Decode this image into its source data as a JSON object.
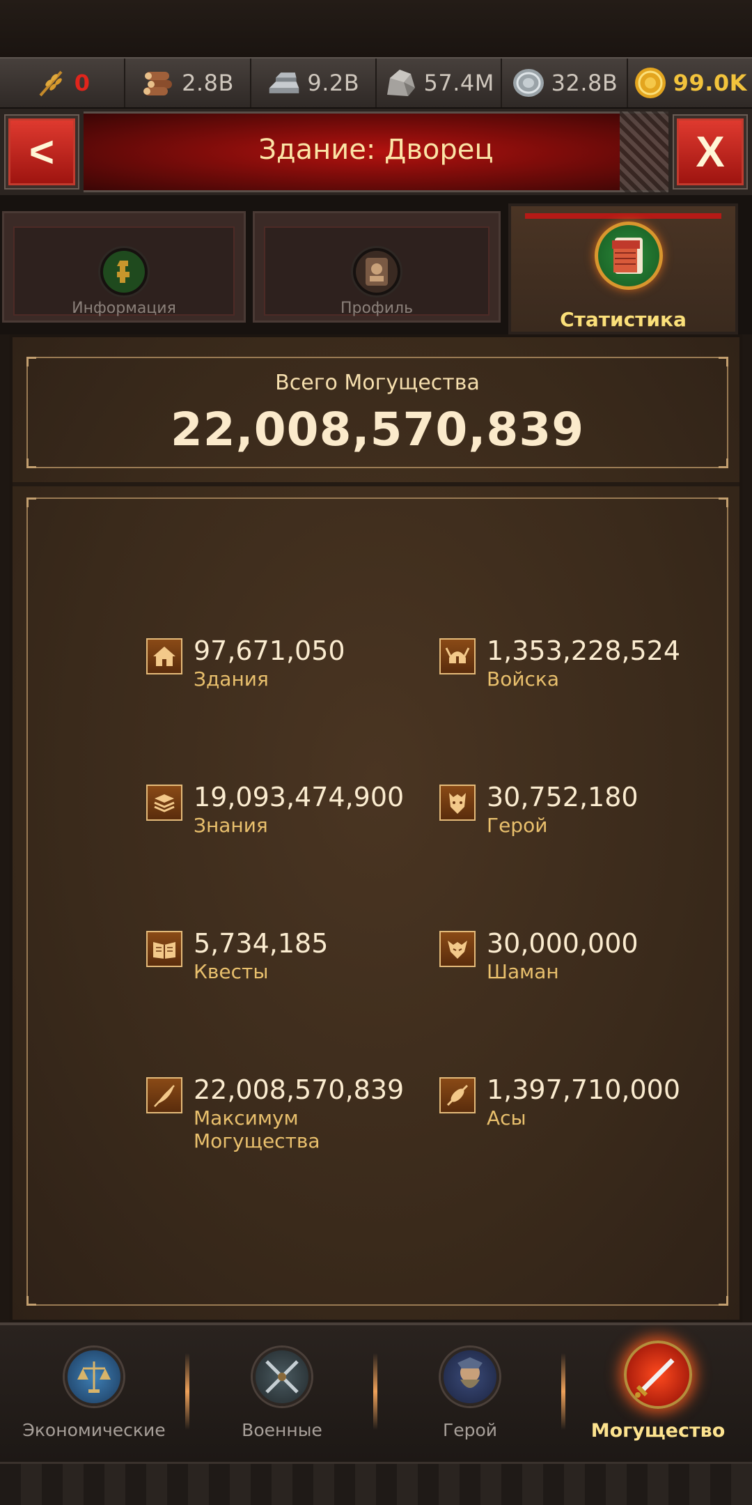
{
  "resources": [
    {
      "icon": "wheat-icon",
      "value": "0",
      "style": "red"
    },
    {
      "icon": "wood-icon",
      "value": "2.8B",
      "style": ""
    },
    {
      "icon": "iron-icon",
      "value": "9.2B",
      "style": ""
    },
    {
      "icon": "stone-icon",
      "value": "57.4M",
      "style": ""
    },
    {
      "icon": "silver-icon",
      "value": "32.8B",
      "style": ""
    },
    {
      "icon": "gold-icon",
      "value": "99.0K",
      "style": "gold"
    }
  ],
  "header": {
    "title": "Здание:  Дворец",
    "back_label": "<",
    "close_label": "X"
  },
  "tabs": [
    {
      "label": "Информация",
      "icon": "info-icon",
      "active": false
    },
    {
      "label": "Профиль",
      "icon": "profile-icon",
      "active": false
    },
    {
      "label": "Статистика",
      "icon": "statistics-icon",
      "active": true
    }
  ],
  "total": {
    "label": "Всего Могущества",
    "value": "22,008,570,839"
  },
  "stats": [
    {
      "icon": "house-icon",
      "value": "97,671,050",
      "label": "Здания"
    },
    {
      "icon": "helmet-icon",
      "value": "1,353,228,524",
      "label": "Войска"
    },
    {
      "icon": "books-icon",
      "value": "19,093,474,900",
      "label": "Знания"
    },
    {
      "icon": "hero-icon",
      "value": "30,752,180",
      "label": "Герой"
    },
    {
      "icon": "open-book-icon",
      "value": "5,734,185",
      "label": "Квесты"
    },
    {
      "icon": "shaman-icon",
      "value": "30,000,000",
      "label": "Шаман"
    },
    {
      "icon": "feather-icon",
      "value": "22,008,570,839",
      "label": "Максимум Могущества"
    },
    {
      "icon": "ace-icon",
      "value": "1,397,710,000",
      "label": "Асы"
    }
  ],
  "bottom_nav": [
    {
      "label": "Экономические",
      "icon": "scales-icon",
      "active": false
    },
    {
      "label": "Военные",
      "icon": "swords-icon",
      "active": false
    },
    {
      "label": "Герой",
      "icon": "hero-portrait-icon",
      "active": false
    },
    {
      "label": "Могущество",
      "icon": "flaming-sword-icon",
      "active": true
    }
  ],
  "colors": {
    "accent_red": "#b3120f",
    "gold_text": "#fbe07a",
    "panel_brown": "#3a2a1b"
  }
}
